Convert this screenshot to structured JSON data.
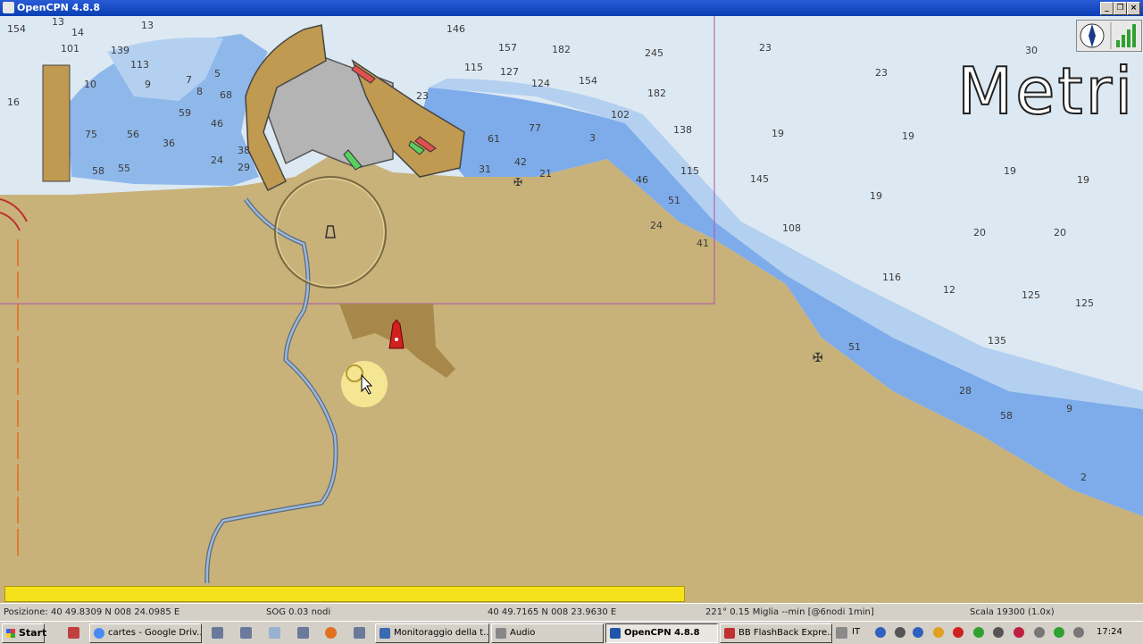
{
  "window": {
    "title": "OpenCPN 4.8.8"
  },
  "chart": {
    "units_label": "Metri",
    "soundings": [
      {
        "v": "154"
      },
      {
        "v": "13"
      },
      {
        "v": "14"
      },
      {
        "v": "13"
      },
      {
        "v": "139"
      },
      {
        "v": "113"
      },
      {
        "v": "101"
      },
      {
        "v": "9"
      },
      {
        "v": "10"
      },
      {
        "v": "7"
      },
      {
        "v": "8"
      },
      {
        "v": "68"
      },
      {
        "v": "5"
      },
      {
        "v": "59"
      },
      {
        "v": "46"
      },
      {
        "v": "75"
      },
      {
        "v": "56"
      },
      {
        "v": "36"
      },
      {
        "v": "24"
      },
      {
        "v": "29"
      },
      {
        "v": "38"
      },
      {
        "v": "58"
      },
      {
        "v": "55"
      },
      {
        "v": "146"
      },
      {
        "v": "157"
      },
      {
        "v": "182"
      },
      {
        "v": "245"
      },
      {
        "v": "115"
      },
      {
        "v": "127"
      },
      {
        "v": "124"
      },
      {
        "v": "154"
      },
      {
        "v": "182"
      },
      {
        "v": "102"
      },
      {
        "v": "23"
      },
      {
        "v": "61"
      },
      {
        "v": "77"
      },
      {
        "v": "138"
      },
      {
        "v": "42"
      },
      {
        "v": "31"
      },
      {
        "v": "21"
      },
      {
        "v": "46"
      },
      {
        "v": "115"
      },
      {
        "v": "145"
      },
      {
        "v": "51"
      },
      {
        "v": "24"
      },
      {
        "v": "41"
      },
      {
        "v": "108"
      },
      {
        "v": "23"
      },
      {
        "v": "30"
      },
      {
        "v": "23"
      },
      {
        "v": "19"
      },
      {
        "v": "19"
      },
      {
        "v": "19"
      },
      {
        "v": "19"
      },
      {
        "v": "19"
      },
      {
        "v": "20"
      },
      {
        "v": "20"
      },
      {
        "v": "116"
      },
      {
        "v": "12"
      },
      {
        "v": "125"
      },
      {
        "v": "125"
      },
      {
        "v": "135"
      },
      {
        "v": "51"
      },
      {
        "v": "28"
      },
      {
        "v": "58"
      },
      {
        "v": "2"
      },
      {
        "v": "16"
      },
      {
        "v": "3"
      },
      {
        "v": "9"
      }
    ]
  },
  "status": {
    "position": "Posizione: 40 49.8309 N   008 24.0985 E",
    "sog": "SOG 0.03 nodi",
    "cursor": "40 49.7165 N   008 23.9630 E",
    "bearing": "221°  0.15 Miglia  --min [@6nodi 1min]",
    "scale": "Scala 19300 (1.0x)"
  },
  "taskbar": {
    "start": "Start",
    "tasks": [
      {
        "label": "cartes - Google Driv...",
        "color": "#4a8af4"
      },
      {
        "label": "Monitoraggio della t...",
        "color": "#3a6ab0"
      },
      {
        "label": "Audio",
        "color": "#888888"
      },
      {
        "label": "OpenCPN 4.8.8",
        "color": "#2255aa"
      },
      {
        "label": "BB FlashBack Expre...",
        "color": "#c03030"
      }
    ],
    "lang": "IT",
    "clock": "17:24"
  }
}
